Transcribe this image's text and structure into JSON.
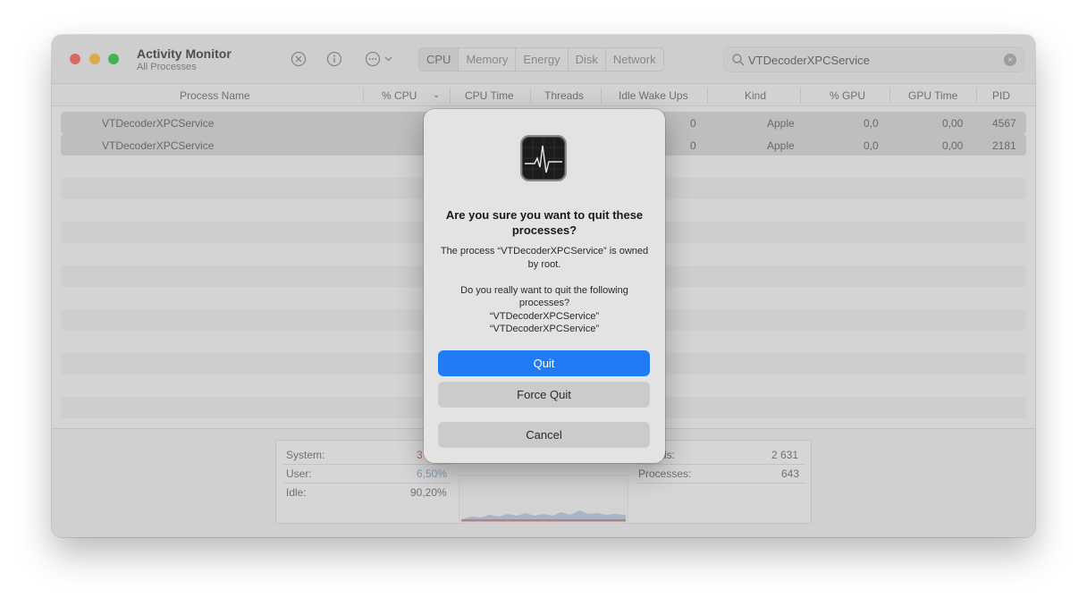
{
  "window": {
    "title": "Activity Monitor",
    "subtitle": "All Processes"
  },
  "toolbar": {
    "tabs": [
      "CPU",
      "Memory",
      "Energy",
      "Disk",
      "Network"
    ],
    "active_tab": "CPU",
    "icons": [
      "stop-process-icon",
      "info-icon",
      "more-options-icon"
    ]
  },
  "search": {
    "value": "VTDecoderXPCService"
  },
  "columns": [
    "Process Name",
    "% CPU",
    "CPU Time",
    "Threads",
    "Idle Wake Ups",
    "Kind",
    "% GPU",
    "GPU Time",
    "PID"
  ],
  "processes": [
    {
      "name": "VTDecoderXPCService",
      "idle_wake_ups": "0",
      "kind": "Apple",
      "gpu": "0,0",
      "gpu_time": "0,00",
      "pid": "4567"
    },
    {
      "name": "VTDecoderXPCService",
      "idle_wake_ups": "0",
      "kind": "Apple",
      "gpu": "0,0",
      "gpu_time": "0,00",
      "pid": "2181"
    }
  ],
  "footer": {
    "system_label": "System:",
    "system_value": "3",
    "user_label": "User:",
    "user_value": "6,50%",
    "idle_label": "Idle:",
    "idle_value": "90,20%",
    "threads_label": "ds:",
    "threads_value": "2 631",
    "processes_label": "Processes:",
    "processes_value": "643"
  },
  "dialog": {
    "title": "Are you sure you want to quit these processes?",
    "message": "The process “VTDecoderXPCService” is owned by root.\n\nDo you really want to quit the following processes?\n“VTDecoderXPCService”\n“VTDecoderXPCService”",
    "quit_label": "Quit",
    "force_quit_label": "Force Quit",
    "cancel_label": "Cancel"
  },
  "colors": {
    "accent": "#1f7cf5",
    "system_graph": "#d9534f",
    "user_graph": "#5b8fd8"
  }
}
